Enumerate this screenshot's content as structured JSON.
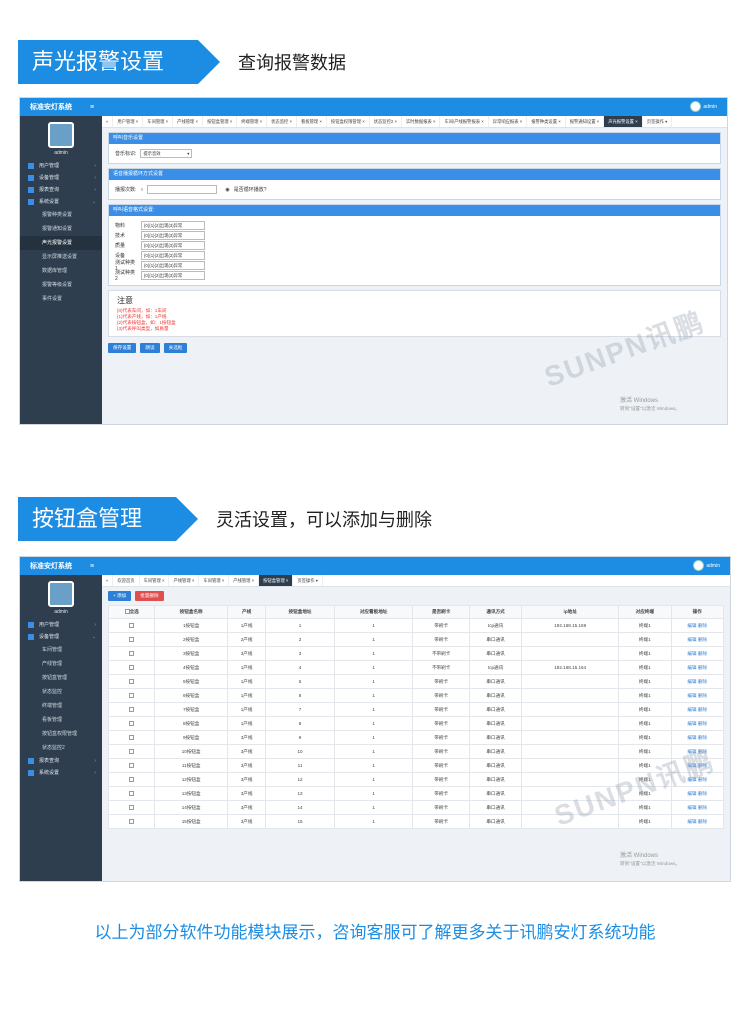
{
  "section1": {
    "tag": "声光报警设置",
    "sub": "查询报警数据"
  },
  "section2": {
    "tag": "按钮盒管理",
    "sub": "灵活设置，可以添加与删除"
  },
  "app": {
    "brand": "标准安灯系统",
    "menu_icon": "≡",
    "user": "admin"
  },
  "screen1": {
    "sidebar": [
      {
        "label": "用户管理",
        "children": []
      },
      {
        "label": "设备管理",
        "children": []
      },
      {
        "label": "报表查询",
        "children": []
      },
      {
        "label": "系统设置",
        "children": [
          "报警种类设置",
          "报警通知设置",
          "声光报警设置",
          "显示屏推送设置",
          "数据库管理",
          "报警等级设置",
          "事件设置"
        ]
      }
    ],
    "tabs": [
      "用户管理 ×",
      "车间管理 ×",
      "产线管理 ×",
      "按钮盒管理 ×",
      "终端管理 ×",
      "状态监控 ×",
      "看板管理 ×",
      "按钮盒权限管理 ×",
      "状态监控2 ×",
      "实时数据报表 ×",
      "车间/产线报警报表 ×",
      "异常响应报表 ×",
      "报警种类设置 ×",
      "报警通知设置 ×",
      "声光报警设置 ×",
      "页签操作 ▾"
    ],
    "panel1": {
      "title": "呼叫音乐设置",
      "label": "音乐标识:",
      "value": "提示音效"
    },
    "panel2": {
      "title": "语音播报循环方式设置",
      "label": "播报次数:",
      "radio2": "是否循环播放?"
    },
    "panel3": {
      "title": "呼叫语音格式设置:",
      "rows": [
        {
          "label": "物料",
          "value": "{0}{1}{2}出现{3}异常"
        },
        {
          "label": "技术",
          "value": "{0}{1}{2}出现{3}异常"
        },
        {
          "label": "质量",
          "value": "{0}{1}{2}出现{3}异常"
        },
        {
          "label": "设备",
          "value": "{0}{1}{2}出现{3}异常"
        },
        {
          "label": "测试种类1",
          "value": "{0}{1}{2}出现{3}异常"
        },
        {
          "label": "测试种类2",
          "value": "{0}{1}{2}出现{3}异常"
        }
      ]
    },
    "note": {
      "title": "注意",
      "lines": [
        "{0}代表车间，如：1车间",
        "{1}代表产线，如：1产线",
        "{2}代表按钮盒，如：1按钮盒",
        "{3}代表呼叫类型，如质量"
      ]
    },
    "buttons": [
      "保存设置",
      "朗读",
      "关选框"
    ],
    "watermark": "SUNPN讯鹏",
    "activate": [
      "激活 Windows",
      "转到\"设置\"以激活 Windows。"
    ]
  },
  "screen2": {
    "sidebar": [
      {
        "label": "用户管理",
        "children": []
      },
      {
        "label": "设备管理",
        "children": [
          "车间管理",
          "产线管理",
          "按钮盒管理",
          "状态监控",
          "终端管理",
          "看板管理",
          "按钮盒权限管理",
          "状态监控2"
        ]
      },
      {
        "label": "报表查询",
        "children": []
      },
      {
        "label": "系统设置",
        "children": []
      }
    ],
    "tabs": [
      "欢迎首页",
      "车间管理 ×",
      "产线管理 ×",
      "车间管理 ×",
      "产线管理 ×",
      "按钮盒管理 ×",
      "页签操作 ▾"
    ],
    "toolbar": {
      "add": "+ 添加",
      "delete": "批量删除"
    },
    "columns": [
      "全选",
      "按钮盒名称",
      "产线",
      "按钮盒地址",
      "对应看板地址",
      "是否刷卡",
      "通讯方式",
      "ip地址",
      "对应终端",
      "操作"
    ],
    "rows": [
      [
        "1按钮盒",
        "1产线",
        "1",
        "1",
        "带刷卡",
        "tcp通讯",
        "192.168.15.169",
        "终端1",
        "编辑 删除"
      ],
      [
        "2按钮盒",
        "2产线",
        "2",
        "1",
        "带刷卡",
        "串口通讯",
        "",
        "终端1",
        "编辑 删除"
      ],
      [
        "3按钮盒",
        "3产线",
        "3",
        "1",
        "不带刷卡",
        "串口通讯",
        "",
        "终端1",
        "编辑 删除"
      ],
      [
        "4按钮盒",
        "1产线",
        "4",
        "1",
        "不带刷卡",
        "tcp通讯",
        "192.168.15.164",
        "终端1",
        "编辑 删除"
      ],
      [
        "5按钮盒",
        "1产线",
        "5",
        "1",
        "带刷卡",
        "串口通讯",
        "",
        "终端1",
        "编辑 删除"
      ],
      [
        "6按钮盒",
        "1产线",
        "6",
        "1",
        "带刷卡",
        "串口通讯",
        "",
        "终端1",
        "编辑 删除"
      ],
      [
        "7按钮盒",
        "1产线",
        "7",
        "1",
        "带刷卡",
        "串口通讯",
        "",
        "终端1",
        "编辑 删除"
      ],
      [
        "8按钮盒",
        "1产线",
        "8",
        "1",
        "带刷卡",
        "串口通讯",
        "",
        "终端1",
        "编辑 删除"
      ],
      [
        "9按钮盒",
        "3产线",
        "9",
        "1",
        "带刷卡",
        "串口通讯",
        "",
        "终端1",
        "编辑 删除"
      ],
      [
        "10按钮盒",
        "3产线",
        "10",
        "1",
        "带刷卡",
        "串口通讯",
        "",
        "终端1",
        "编辑 删除"
      ],
      [
        "11按钮盒",
        "3产线",
        "11",
        "1",
        "带刷卡",
        "串口通讯",
        "",
        "终端1",
        "编辑 删除"
      ],
      [
        "12按钮盒",
        "3产线",
        "12",
        "1",
        "带刷卡",
        "串口通讯",
        "",
        "终端1",
        "编辑 删除"
      ],
      [
        "13按钮盒",
        "3产线",
        "13",
        "1",
        "带刷卡",
        "串口通讯",
        "",
        "终端1",
        "编辑 删除"
      ],
      [
        "14按钮盒",
        "3产线",
        "14",
        "1",
        "带刷卡",
        "串口通讯",
        "",
        "终端1",
        "编辑 删除"
      ],
      [
        "15按钮盒",
        "3产线",
        "15",
        "1",
        "带刷卡",
        "串口通讯",
        "",
        "终端1",
        "编辑 删除"
      ]
    ],
    "watermark": "SUNPN讯鹏",
    "activate": [
      "激活 Windows",
      "转到\"设置\"以激活 Windows。"
    ]
  },
  "footer": "以上为部分软件功能模块展示，咨询客服可了解更多关于讯鹏安灯系统功能"
}
